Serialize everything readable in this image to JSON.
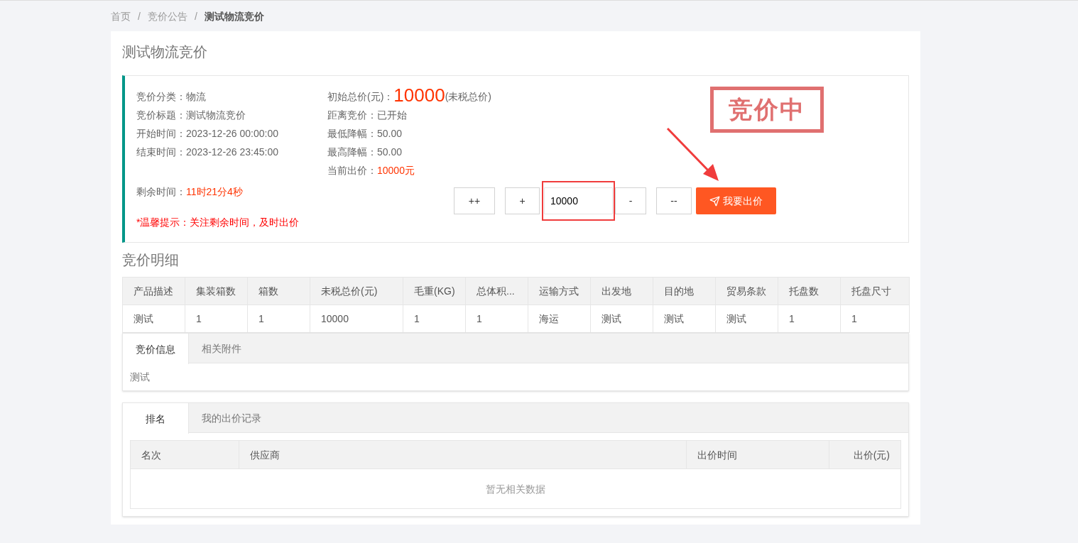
{
  "breadcrumb": [
    {
      "label": "首页",
      "current": false
    },
    {
      "label": "竞价公告",
      "current": false
    },
    {
      "label": "测试物流竞价",
      "current": true
    }
  ],
  "breadcrumb_separator": "/",
  "title": "测试物流竞价",
  "info": {
    "left": [
      {
        "label": "竞价分类：",
        "value": "物流",
        "highlight": false
      },
      {
        "label": "竞价标题：",
        "value": "测试物流竞价",
        "highlight": false
      },
      {
        "label": "开始时间：",
        "value": "2023-12-26 00:00:00",
        "highlight": false
      },
      {
        "label": "结束时间：",
        "value": "2023-12-26 23:45:00",
        "highlight": false
      }
    ],
    "remaining": {
      "label": "剩余时间：",
      "value": "11时21分4秒"
    },
    "tip": "*温馨提示：关注剩余时间，及时出价",
    "price": {
      "label": "初始总价(元)：",
      "value": "10000",
      "note": "(未税总价)"
    },
    "middle": [
      {
        "label": "距离竞价：",
        "value": "已开始",
        "highlight": false
      },
      {
        "label": "最低降幅：",
        "value": "50.00",
        "highlight": false
      },
      {
        "label": "最高降幅：",
        "value": "50.00",
        "highlight": false
      },
      {
        "label": "当前出价：",
        "value": "10000元",
        "highlight": true
      }
    ],
    "stamp": "竞价中",
    "controls": {
      "big_up": "++",
      "up": "+",
      "amount": "10000",
      "down": "-",
      "big_down": "--",
      "submit": "我要出价"
    }
  },
  "detail": {
    "title": "竞价明细",
    "columns": [
      "产品描述",
      "集装箱数",
      "箱数",
      "未税总价(元)",
      "毛重(KG)",
      "总体积...",
      "运输方式",
      "出发地",
      "目的地",
      "贸易条款",
      "托盘数",
      "托盘尺寸"
    ],
    "rows": [
      [
        "测试",
        "1",
        "1",
        "10000",
        "1",
        "1",
        "海运",
        "测试",
        "测试",
        "测试",
        "1",
        "1"
      ]
    ]
  },
  "info_tabs": [
    {
      "label": "竞价信息",
      "selected": true
    },
    {
      "label": "相关附件",
      "selected": false
    }
  ],
  "info_tab_content": "测试",
  "ranking_tabs": [
    {
      "label": "排名",
      "selected": true
    },
    {
      "label": "我的出价记录",
      "selected": false
    }
  ],
  "ranking": {
    "columns": [
      "名次",
      "供应商",
      "出价时间",
      "出价(元)"
    ],
    "empty_text": "暂无相关数据"
  }
}
